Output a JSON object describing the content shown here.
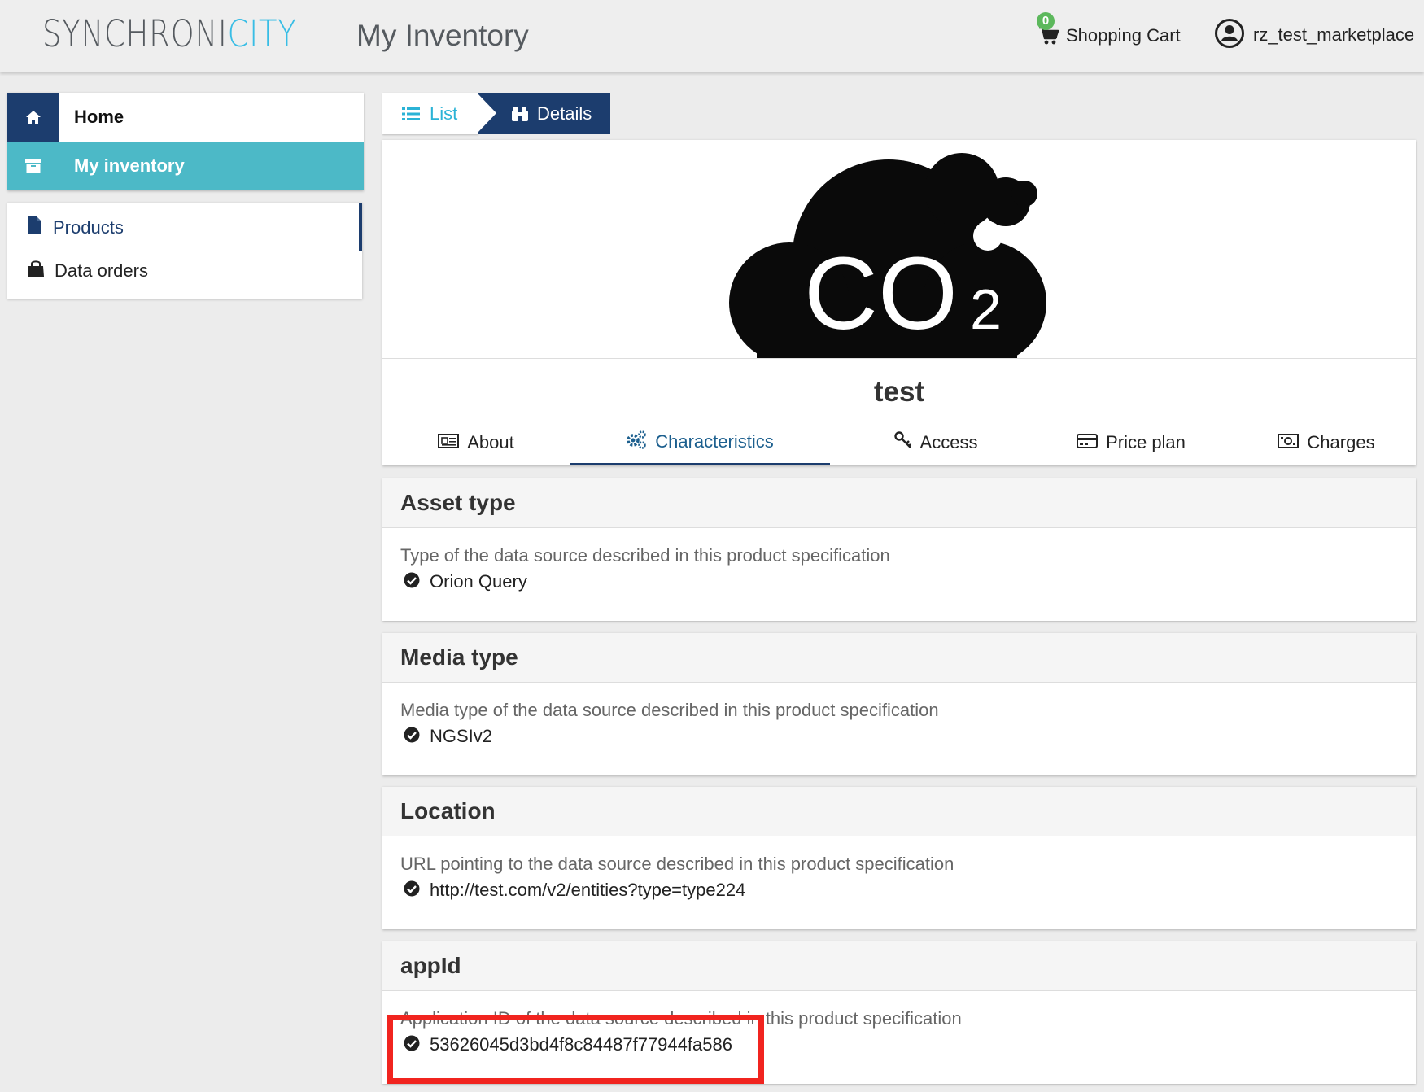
{
  "header": {
    "logo_part1": "SYNCHRONI",
    "logo_part2": "CITY",
    "app_title": "My Inventory",
    "cart_count": "0",
    "cart_label": "Shopping Cart",
    "username": "rz_test_marketplace"
  },
  "sidebar": {
    "home_label": "Home",
    "inventory_label": "My inventory",
    "sub_items": [
      {
        "label": "Products",
        "icon": "file-icon"
      },
      {
        "label": "Data orders",
        "icon": "shopping-bag-icon"
      }
    ]
  },
  "breadcrumb": {
    "list_label": "List",
    "details_label": "Details"
  },
  "product": {
    "name": "test",
    "image_text_main": "CO",
    "image_text_sub": "2",
    "tabs": [
      {
        "label": "About",
        "icon": "newspaper-icon"
      },
      {
        "label": "Characteristics",
        "icon": "cogs-icon"
      },
      {
        "label": "Access",
        "icon": "key-icon"
      },
      {
        "label": "Price plan",
        "icon": "credit-card-icon"
      },
      {
        "label": "Charges",
        "icon": "money-icon"
      }
    ],
    "active_tab": "Characteristics"
  },
  "characteristics": [
    {
      "title": "Asset type",
      "description": "Type of the data source described in this product specification",
      "value": "Orion Query"
    },
    {
      "title": "Media type",
      "description": "Media type of the data source described in this product specification",
      "value": "NGSIv2"
    },
    {
      "title": "Location",
      "description": "URL pointing to the data source described in this product specification",
      "value": "http://test.com/v2/entities?type=type224"
    },
    {
      "title": "appId",
      "description": "Application ID of the data source described in this product specification",
      "value": "53626045d3bd4f8c84487f77944fa586"
    }
  ],
  "colors": {
    "navy": "#1c3d6e",
    "teal": "#4cb9c7",
    "link_blue": "#2bb3d6",
    "highlight_red": "#f1241f"
  }
}
